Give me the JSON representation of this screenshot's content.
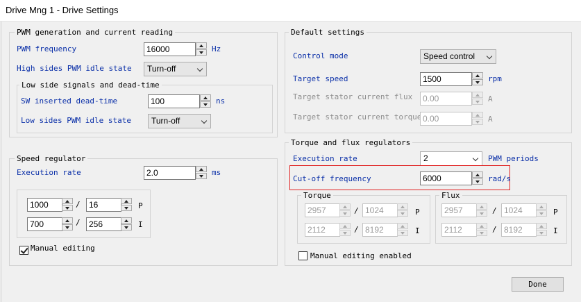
{
  "window": {
    "title": "Drive Mng 1 - Drive Settings"
  },
  "pwm": {
    "group_title": "PWM generation and current reading",
    "pwm_frequency_label": "PWM frequency",
    "pwm_frequency_value": "16000",
    "pwm_frequency_unit": "Hz",
    "high_sides_label": "High sides PWM idle state",
    "high_sides_value": "Turn-off",
    "low_side_group_title": "Low side signals and dead-time",
    "dead_time_label": "SW inserted dead-time",
    "dead_time_value": "100",
    "dead_time_unit": "ns",
    "low_sides_label": "Low sides PWM idle state",
    "low_sides_value": "Turn-off"
  },
  "speed": {
    "group_title": "Speed regulator",
    "execution_rate_label": "Execution rate",
    "execution_rate_value": "2.0",
    "execution_rate_unit": "ms",
    "p_num": "1000",
    "p_den": "16",
    "p_label": "P",
    "i_num": "700",
    "i_den": "256",
    "i_label": "I",
    "manual_editing_label": "Manual editing",
    "manual_editing_checked": true
  },
  "defaults": {
    "group_title": "Default settings",
    "control_mode_label": "Control mode",
    "control_mode_value": "Speed control",
    "target_speed_label": "Target speed",
    "target_speed_value": "1500",
    "target_speed_unit": "rpm",
    "stator_flux_label": "Target stator current flux",
    "stator_flux_value": "0.00",
    "stator_flux_unit": "A",
    "stator_torque_label": "Target stator current torque",
    "stator_torque_value": "0.00",
    "stator_torque_unit": "A"
  },
  "regulators": {
    "group_title": "Torque and flux regulators",
    "execution_rate_label": "Execution rate",
    "execution_rate_value": "2",
    "execution_rate_unit": "PWM periods",
    "cutoff_label": "Cut-off frequency",
    "cutoff_value": "6000",
    "cutoff_unit": "rad/s",
    "torque": {
      "title": "Torque",
      "p_num": "2957",
      "p_den": "1024",
      "p_label": "P",
      "i_num": "2112",
      "i_den": "8192",
      "i_label": "I"
    },
    "flux": {
      "title": "Flux",
      "p_num": "2957",
      "p_den": "1024",
      "p_label": "P",
      "i_num": "2112",
      "i_den": "8192",
      "i_label": "I"
    },
    "manual_editing_label": "Manual editing enabled",
    "manual_editing_checked": false
  },
  "buttons": {
    "done_label": "Done"
  },
  "colors": {
    "label_blue": "#0a2fa8",
    "highlight_red": "#e02020",
    "disabled_gray": "#8d8d8d"
  },
  "slash": "/"
}
